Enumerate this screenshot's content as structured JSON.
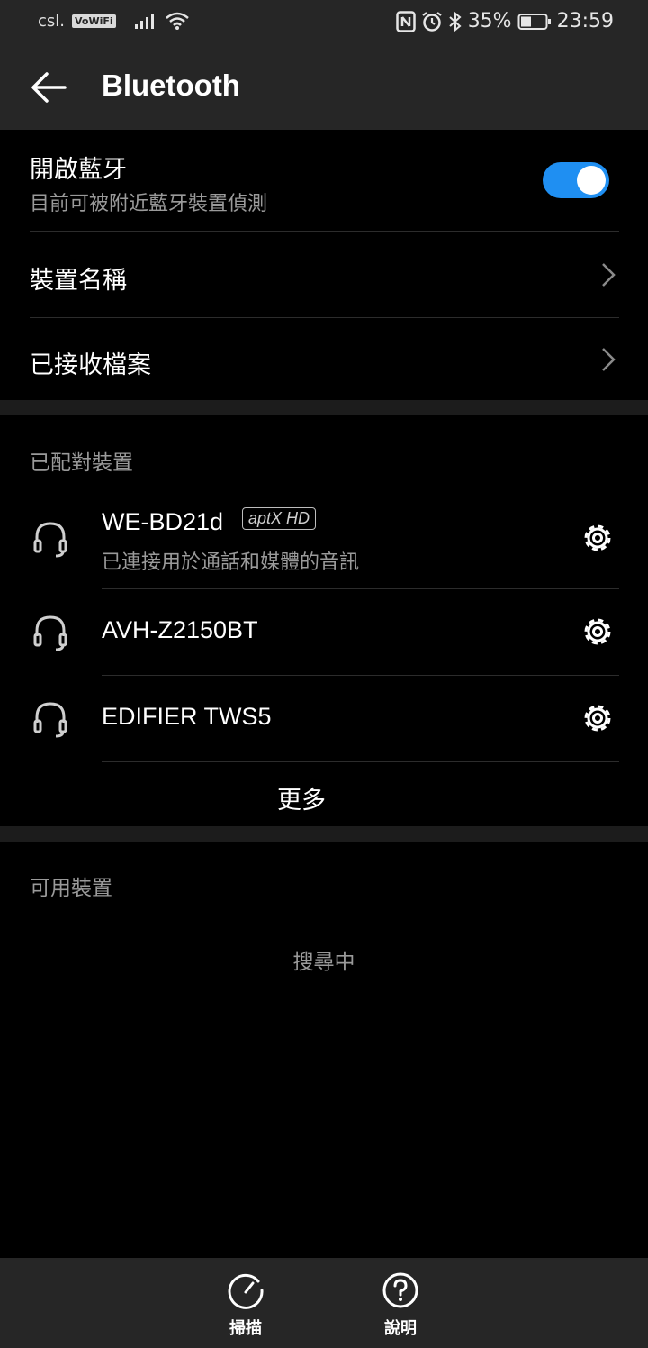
{
  "status_bar": {
    "carrier": "csl.",
    "vowifi": "VoWiFi",
    "battery": "35%",
    "time": "23:59",
    "icons": [
      "signal-icon",
      "wifi-icon",
      "nfc-icon",
      "alarm-icon",
      "bluetooth-icon",
      "battery-icon"
    ]
  },
  "header": {
    "title": "Bluetooth",
    "back_icon": "arrow-left-icon"
  },
  "settings": {
    "bluetooth_toggle": {
      "label": "開啟藍牙",
      "sub": "目前可被附近藍牙裝置偵測",
      "on": true
    },
    "device_name": {
      "label": "裝置名稱"
    },
    "received_files": {
      "label": "已接收檔案"
    }
  },
  "paired": {
    "title": "已配對裝置",
    "devices": [
      {
        "name": "WE-BD21d",
        "codec": "aptX HD",
        "status": "已連接用於通話和媒體的音訊"
      },
      {
        "name": "AVH-Z2150BT"
      },
      {
        "name": "EDIFIER TWS5"
      }
    ],
    "more": "更多"
  },
  "available": {
    "title": "可用裝置",
    "status": "搜尋中"
  },
  "bottom_bar": {
    "scan": {
      "label": "掃描",
      "icon": "refresh-icon"
    },
    "help": {
      "label": "說明",
      "icon": "help-icon"
    }
  },
  "colors": {
    "accent": "#1f8ff2",
    "bar": "#262626",
    "background": "#000000",
    "secondary_text": "#9a9a9a"
  }
}
